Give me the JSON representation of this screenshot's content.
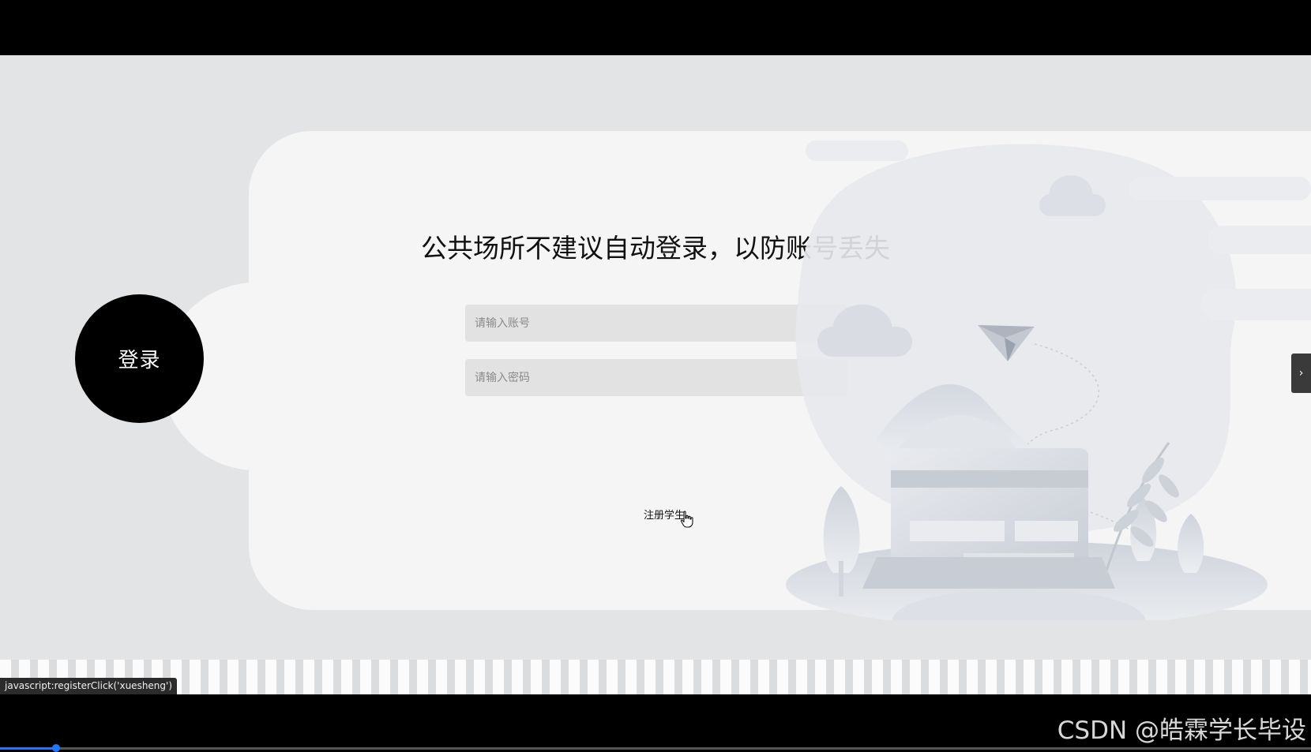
{
  "page": {
    "login_badge": "登录",
    "notice_title": "公共场所不建议自动登录，以防账号丢失",
    "account_placeholder": "请输入账号",
    "password_placeholder": "请输入密码",
    "register_link": "注册学生",
    "side_toggle_glyph": "›",
    "status_url": "javascript:registerClick('xuesheng')"
  },
  "overlay": {
    "watermark": "CSDN @皓霖学长毕设"
  },
  "video": {
    "progress_percent": 4.3
  },
  "colors": {
    "background": "#e3e4e6",
    "card": "#f5f5f5",
    "badge": "#000000",
    "field": "#e2e2e2",
    "progress": "#1e78ff"
  },
  "icons": {
    "cursor": "hand-pointer-icon",
    "paper_plane": "paper-plane-icon",
    "side_toggle": "chevron-right-icon"
  }
}
